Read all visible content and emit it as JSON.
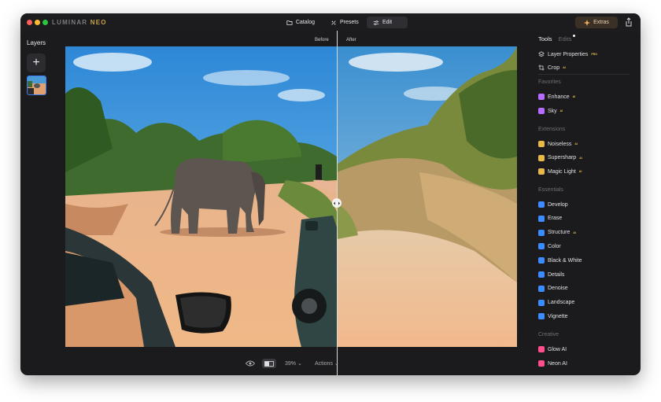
{
  "app": {
    "logo_main": "LUMINAR",
    "logo_accent": "NEO"
  },
  "nav": {
    "catalog": "Catalog",
    "presets": "Presets",
    "edit": "Edit",
    "extras": "Extras"
  },
  "layers": {
    "title": "Layers",
    "add_label": "+"
  },
  "canvas": {
    "before": "Before",
    "after": "After"
  },
  "bottom": {
    "zoom": "39%",
    "actions": "Actions"
  },
  "panel": {
    "tabs": {
      "tools": "Tools",
      "edits": "Edits"
    },
    "items_top": [
      {
        "label": "Layer Properties",
        "badge": "PRO"
      },
      {
        "label": "Crop",
        "badge": "AI"
      }
    ],
    "sections": {
      "favorites": "Favorites",
      "extensions": "Extensions",
      "essentials": "Essentials",
      "creative": "Creative"
    },
    "favorites": [
      {
        "label": "Enhance",
        "badge": "AI",
        "icon": "enhance-icon",
        "color": "#b86bff"
      },
      {
        "label": "Sky",
        "badge": "AI",
        "icon": "sky-icon",
        "color": "#b86bff"
      }
    ],
    "extensions": [
      {
        "label": "Noiseless",
        "badge": "AI",
        "icon": "noiseless-icon",
        "color": "#e8b84a"
      },
      {
        "label": "Supersharp",
        "badge": "AI",
        "icon": "supersharp-icon",
        "color": "#e8b84a"
      },
      {
        "label": "Magic Light",
        "badge": "AI",
        "icon": "magic-light-icon",
        "color": "#e8b84a"
      }
    ],
    "essentials": [
      {
        "label": "Develop",
        "badge": "",
        "icon": "develop-icon",
        "color": "#3d8cff"
      },
      {
        "label": "Erase",
        "badge": "",
        "icon": "erase-icon",
        "color": "#3d8cff"
      },
      {
        "label": "Structure",
        "badge": "AI",
        "icon": "structure-icon",
        "color": "#3d8cff"
      },
      {
        "label": "Color",
        "badge": "",
        "icon": "color-icon",
        "color": "#3d8cff"
      },
      {
        "label": "Black & White",
        "badge": "",
        "icon": "black-white-icon",
        "color": "#3d8cff"
      },
      {
        "label": "Details",
        "badge": "",
        "icon": "details-icon",
        "color": "#3d8cff"
      },
      {
        "label": "Denoise",
        "badge": "",
        "icon": "denoise-icon",
        "color": "#3d8cff"
      },
      {
        "label": "Landscape",
        "badge": "",
        "icon": "landscape-icon",
        "color": "#3d8cff"
      },
      {
        "label": "Vignette",
        "badge": "",
        "icon": "vignette-icon",
        "color": "#3d8cff"
      }
    ],
    "creative": [
      {
        "label": "Glow AI",
        "badge": "",
        "icon": "glow-icon",
        "color": "#ff4f8b"
      },
      {
        "label": "Neon AI",
        "badge": "",
        "icon": "neon-icon",
        "color": "#ff4f8b"
      }
    ]
  }
}
